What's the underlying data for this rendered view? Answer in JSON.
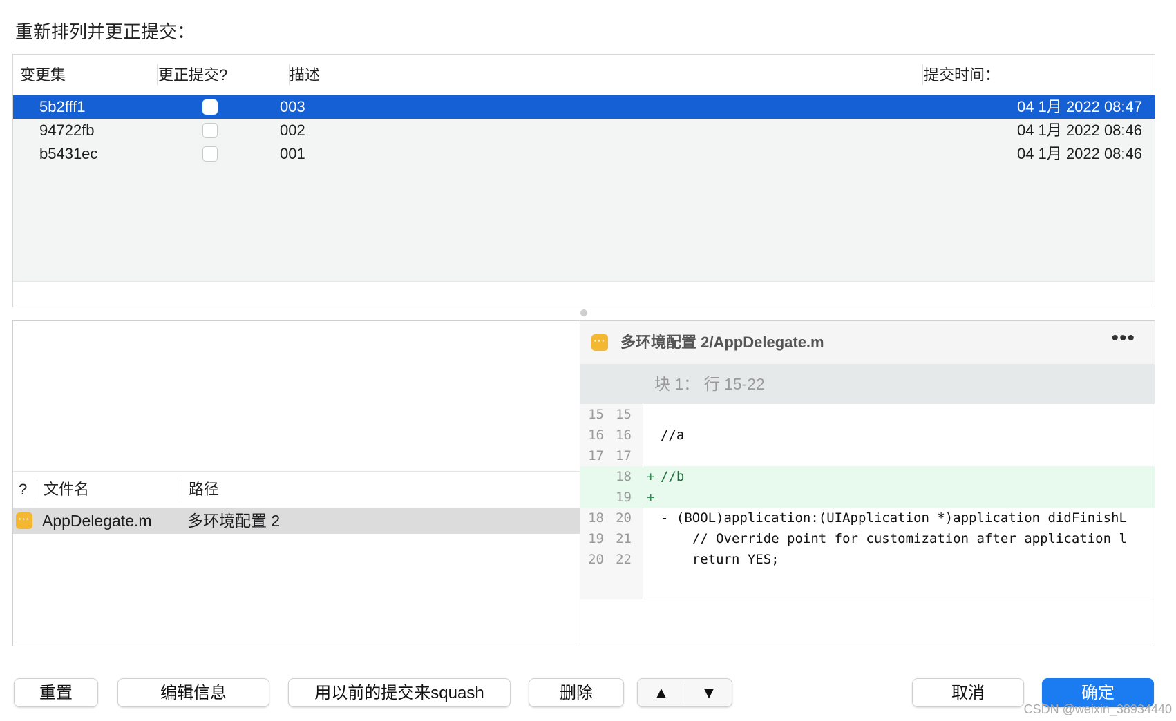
{
  "header": {
    "title": "重新排列并更正提交："
  },
  "commits_table": {
    "columns": [
      "变更集",
      "更正提交?",
      "描述",
      "提交时间："
    ],
    "rows": [
      {
        "changeset": "5b2fff1",
        "fix": false,
        "description": "003",
        "time": "04 1月 2022 08:47",
        "selected": true
      },
      {
        "changeset": "94722fb",
        "fix": false,
        "description": "002",
        "time": "04 1月 2022 08:46",
        "selected": false
      },
      {
        "changeset": "b5431ec",
        "fix": false,
        "description": "001",
        "time": "04 1月 2022 08:46",
        "selected": false
      }
    ]
  },
  "files_table": {
    "columns": [
      "?",
      "文件名",
      "路径"
    ],
    "rows": [
      {
        "status_icon": "modified-icon",
        "name": "AppDelegate.m",
        "path": "多环境配置 2"
      }
    ]
  },
  "diff": {
    "file_title": "多环境配置 2/AppDelegate.m",
    "more_label": "•••",
    "hunk_label": "块 1：  行 15-22",
    "lines": [
      {
        "old": "15",
        "new": "15",
        "sign": "",
        "text": "",
        "added": false
      },
      {
        "old": "16",
        "new": "16",
        "sign": "",
        "text": "//a",
        "added": false
      },
      {
        "old": "17",
        "new": "17",
        "sign": "",
        "text": "",
        "added": false
      },
      {
        "old": "",
        "new": "18",
        "sign": "+",
        "text": "//b",
        "added": true
      },
      {
        "old": "",
        "new": "19",
        "sign": "+",
        "text": "",
        "added": true
      },
      {
        "old": "18",
        "new": "20",
        "sign": "",
        "text": "- (BOOL)application:(UIApplication *)application didFinishL",
        "added": false
      },
      {
        "old": "19",
        "new": "21",
        "sign": "",
        "text": "    // Override point for customization after application l",
        "added": false
      },
      {
        "old": "20",
        "new": "22",
        "sign": "",
        "text": "    return YES;",
        "added": false
      }
    ]
  },
  "buttons": {
    "reset": "重置",
    "edit_message": "编辑信息",
    "squash": "用以前的提交来squash",
    "delete": "删除",
    "move_up": "▲",
    "move_down": "▼",
    "cancel": "取消",
    "ok": "确定"
  },
  "colors": {
    "selection": "#1560d4",
    "primary_button": "#1a7cf0",
    "modified_icon": "#f4b731",
    "added_line_bg": "#e8f9ee"
  },
  "watermark": "CSDN @weixin_38934440"
}
